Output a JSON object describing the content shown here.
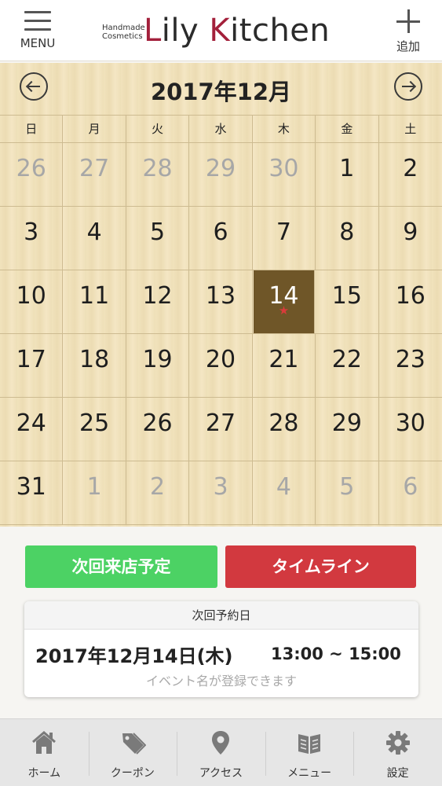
{
  "header": {
    "menu_label": "MENU",
    "logo_small_line1": "Handmade",
    "logo_small_line2": "Cosmetics",
    "logo_word1_initial": "L",
    "logo_word1_rest": "ily ",
    "logo_word2_initial": "K",
    "logo_word2_rest": "itchen",
    "add_label": "追加"
  },
  "calendar": {
    "month_title": "2017年12月",
    "weekdays": [
      "日",
      "月",
      "火",
      "水",
      "木",
      "金",
      "土"
    ],
    "weeks": [
      [
        {
          "d": "26",
          "other": true
        },
        {
          "d": "27",
          "other": true
        },
        {
          "d": "28",
          "other": true
        },
        {
          "d": "29",
          "other": true
        },
        {
          "d": "30",
          "other": true
        },
        {
          "d": "1"
        },
        {
          "d": "2"
        }
      ],
      [
        {
          "d": "3"
        },
        {
          "d": "4"
        },
        {
          "d": "5"
        },
        {
          "d": "6"
        },
        {
          "d": "7"
        },
        {
          "d": "8"
        },
        {
          "d": "9"
        }
      ],
      [
        {
          "d": "10"
        },
        {
          "d": "11"
        },
        {
          "d": "12"
        },
        {
          "d": "13"
        },
        {
          "d": "14",
          "today": true,
          "mark": "★"
        },
        {
          "d": "15"
        },
        {
          "d": "16"
        }
      ],
      [
        {
          "d": "17"
        },
        {
          "d": "18"
        },
        {
          "d": "19"
        },
        {
          "d": "20"
        },
        {
          "d": "21"
        },
        {
          "d": "22"
        },
        {
          "d": "23"
        }
      ],
      [
        {
          "d": "24"
        },
        {
          "d": "25"
        },
        {
          "d": "26"
        },
        {
          "d": "27"
        },
        {
          "d": "28"
        },
        {
          "d": "29"
        },
        {
          "d": "30"
        }
      ],
      [
        {
          "d": "31"
        },
        {
          "d": "1",
          "other": true
        },
        {
          "d": "2",
          "other": true
        },
        {
          "d": "3",
          "other": true
        },
        {
          "d": "4",
          "other": true
        },
        {
          "d": "5",
          "other": true
        },
        {
          "d": "6",
          "other": true
        }
      ]
    ]
  },
  "actions": {
    "next_visit_label": "次回来店予定",
    "timeline_label": "タイムライン"
  },
  "booking": {
    "heading": "次回予約日",
    "date": "2017年12月14日(木)",
    "time": "13:00 ~ 15:00",
    "event_placeholder": "イベント名が登録できます"
  },
  "tabs": [
    {
      "name": "home",
      "label": "ホーム",
      "icon": "home-icon"
    },
    {
      "name": "coupon",
      "label": "クーポン",
      "icon": "tag-icon"
    },
    {
      "name": "access",
      "label": "アクセス",
      "icon": "map-pin-icon"
    },
    {
      "name": "menu",
      "label": "メニュー",
      "icon": "book-icon"
    },
    {
      "name": "settings",
      "label": "設定",
      "icon": "gear-icon"
    }
  ],
  "colors": {
    "brand_accent": "#a3203b",
    "today_bg": "#6f5628",
    "green_button": "#4cd264",
    "red_button": "#d2393f"
  }
}
